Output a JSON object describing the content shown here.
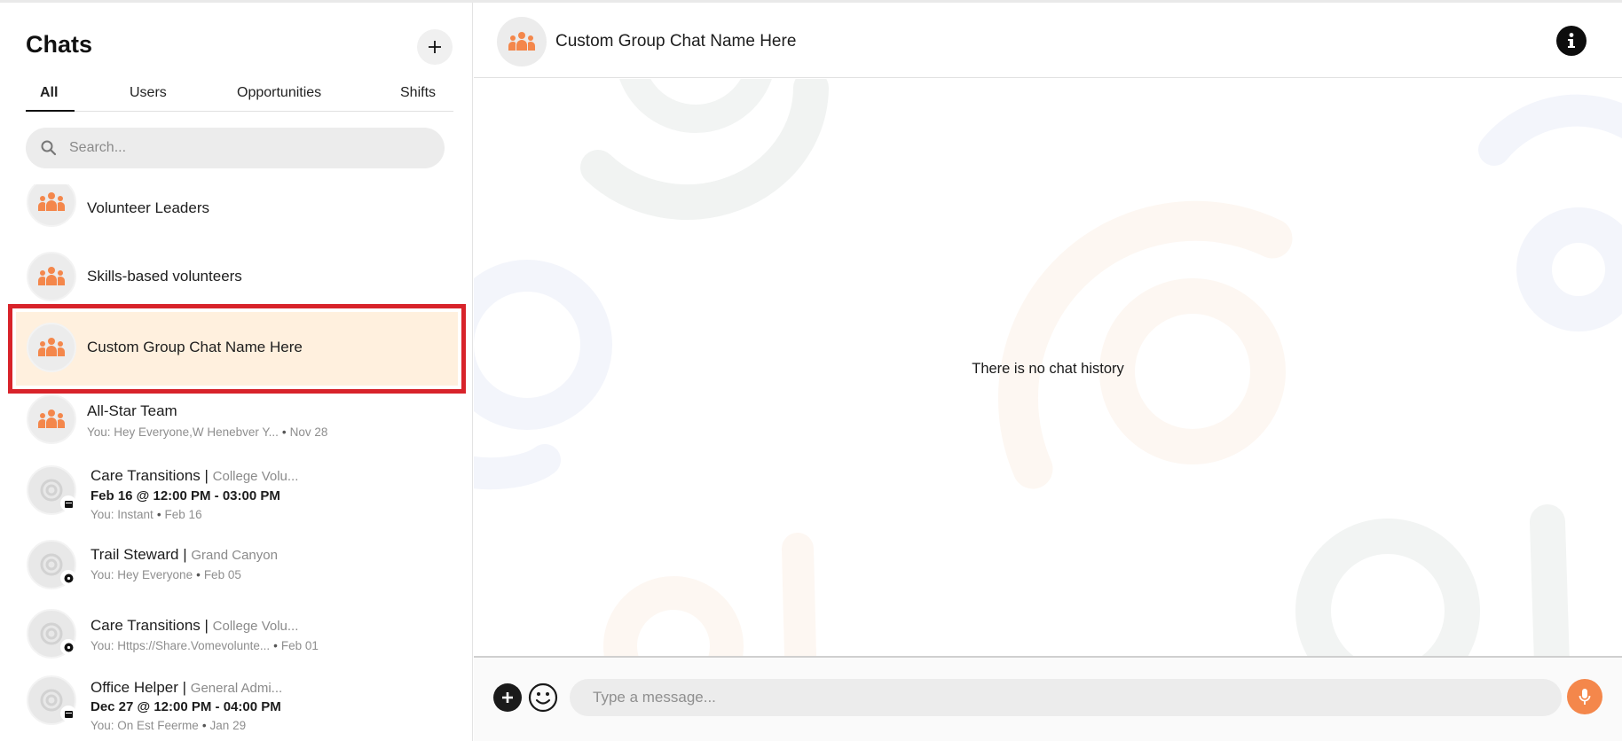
{
  "colors": {
    "accent": "#f4874b",
    "selected_bg": "#fff0de",
    "highlight_border": "#d8232a"
  },
  "sidebar": {
    "title": "Chats",
    "new_chat_icon": "plus-icon",
    "tabs": [
      {
        "label": "All",
        "active": true
      },
      {
        "label": "Users",
        "active": false
      },
      {
        "label": "Opportunities",
        "active": false
      },
      {
        "label": "Shifts",
        "active": false
      }
    ],
    "search": {
      "placeholder": "Search...",
      "icon": "search-icon"
    },
    "chats": [
      {
        "name": "Volunteer Leaders",
        "type": "group"
      },
      {
        "name": "Skills-based volunteers",
        "type": "group"
      },
      {
        "name": "Custom Group Chat Name Here",
        "type": "group",
        "selected": true
      },
      {
        "name": "All-Star Team",
        "type": "group",
        "preview": "You: Hey Everyone,W Henebver Y...",
        "date": "Nov 28"
      },
      {
        "name": "Care Transitions |",
        "org": "College Volu...",
        "type": "shift",
        "shift_time": "Feb 16 @ 12:00 PM - 03:00 PM",
        "preview": "You: Instant",
        "date": "Feb 16"
      },
      {
        "name": "Trail Steward |",
        "org": "Grand Canyon",
        "type": "opportunity",
        "preview": "You: Hey Everyone",
        "date": "Feb 05"
      },
      {
        "name": "Care Transitions |",
        "org": "College Volu...",
        "type": "opportunity",
        "preview": "You: Https://Share.Vomevolunte...",
        "date": "Feb 01"
      },
      {
        "name": "Office Helper |",
        "org": "General Admi...",
        "type": "shift",
        "shift_time": "Dec 27 @ 12:00 PM - 04:00 PM",
        "preview": "You: On Est Feerme",
        "date": "Jan 29"
      }
    ]
  },
  "main": {
    "header": {
      "title": "Custom Group Chat Name Here",
      "info_icon": "info-icon"
    },
    "empty_text": "There is no chat history",
    "composer": {
      "placeholder": "Type a message...",
      "attach_icon": "plus-circle-icon",
      "emoji_icon": "smiley-icon",
      "mic_icon": "microphone-icon"
    }
  }
}
